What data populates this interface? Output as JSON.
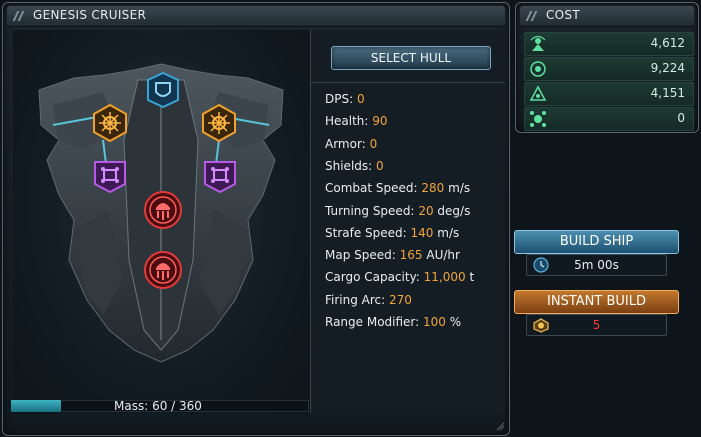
{
  "main_panel": {
    "title": "GENESIS CRUISER"
  },
  "select_hull_label": "SELECT HULL",
  "stats": [
    {
      "label": "DPS:",
      "value": "0",
      "unit": ""
    },
    {
      "label": "Health:",
      "value": "90",
      "unit": ""
    },
    {
      "label": "Armor:",
      "value": "0",
      "unit": ""
    },
    {
      "label": "Shields:",
      "value": "0",
      "unit": ""
    },
    {
      "label": "Combat Speed:",
      "value": "280",
      "unit": "m/s"
    },
    {
      "label": "Turning Speed:",
      "value": "20",
      "unit": "deg/s"
    },
    {
      "label": "Strafe Speed:",
      "value": "140",
      "unit": "m/s"
    },
    {
      "label": "Map Speed:",
      "value": "165",
      "unit": "AU/hr"
    },
    {
      "label": "Cargo Capacity:",
      "value": "11,000",
      "unit": "t"
    },
    {
      "label": "Firing Arc:",
      "value": "270",
      "unit": ""
    },
    {
      "label": "Range Modifier:",
      "value": "100",
      "unit": "%"
    }
  ],
  "mass": {
    "text": "Mass: 60 / 360",
    "current": 60,
    "max": 360
  },
  "cost_panel": {
    "title": "COST",
    "rows": [
      {
        "icon": "resource-a-icon",
        "value": "4,612"
      },
      {
        "icon": "resource-b-icon",
        "value": "9,224"
      },
      {
        "icon": "resource-c-icon",
        "value": "4,151"
      },
      {
        "icon": "resource-d-icon",
        "value": "0"
      }
    ]
  },
  "build_ship": {
    "label": "BUILD SHIP",
    "time": "5m 00s"
  },
  "instant_build": {
    "label": "INSTANT BUILD",
    "cost": "5"
  },
  "colors": {
    "stat_value": "#f0a43a",
    "instant_cost": "#ff3b2f",
    "cost_value": "#cfeee0",
    "build_btn": "#2e6f93",
    "instant_btn": "#a45a1f"
  }
}
